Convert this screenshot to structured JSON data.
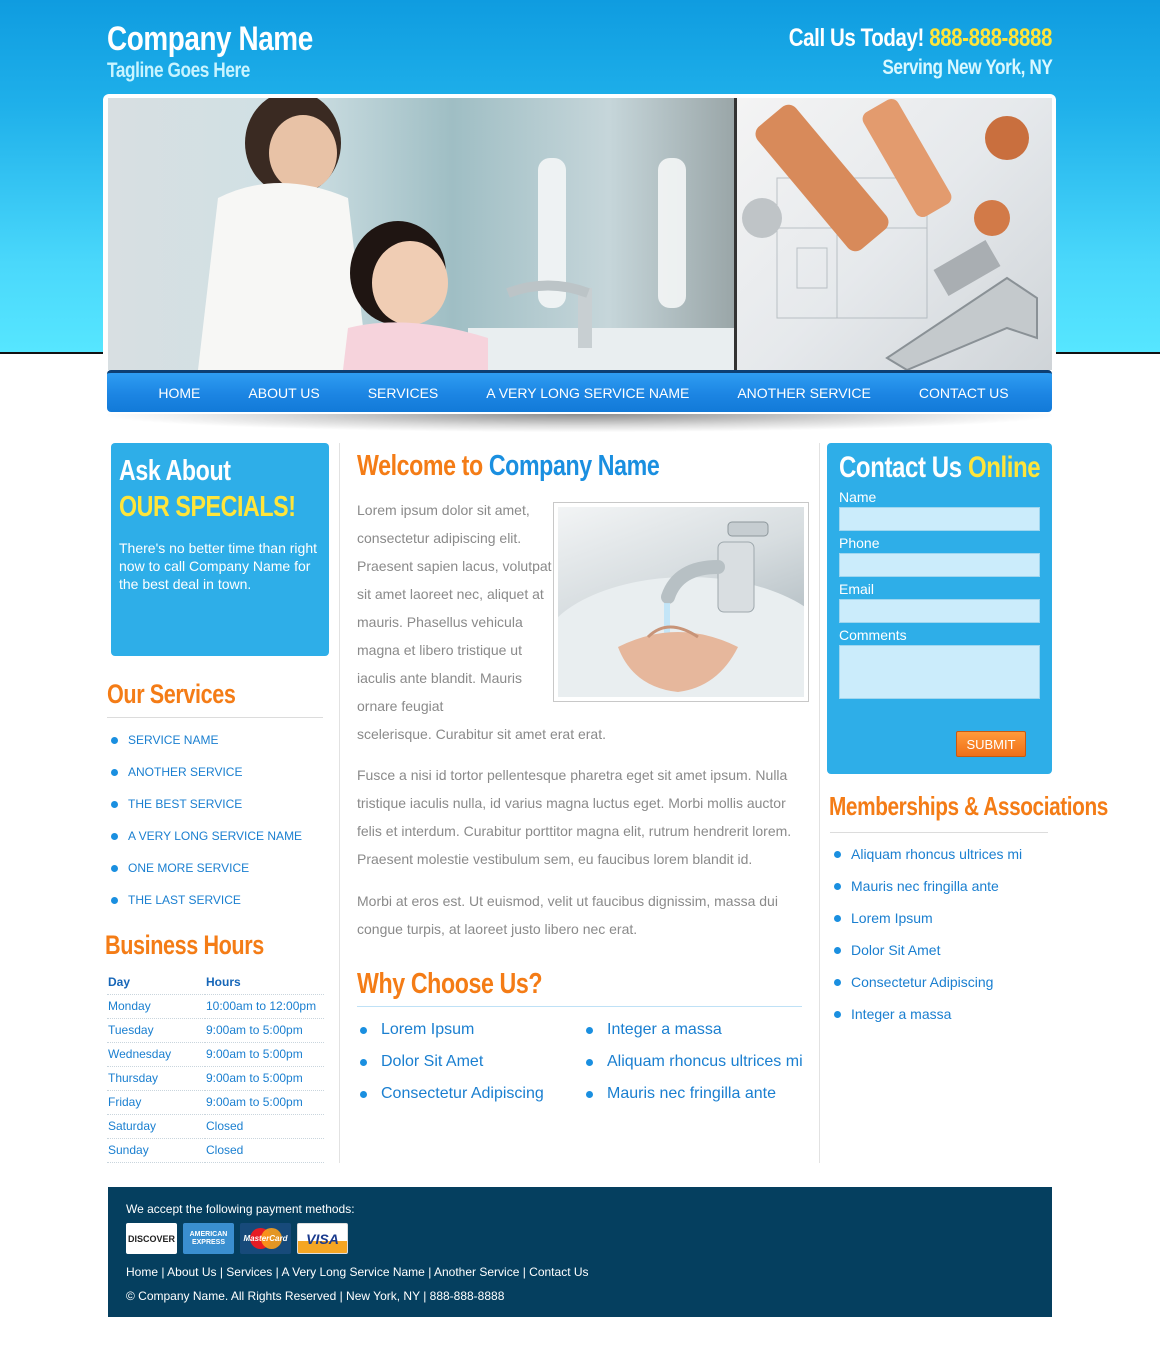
{
  "header": {
    "company_name": "Company Name",
    "tagline": "Tagline Goes Here",
    "call_label": "Call Us Today!",
    "phone": "888-888-8888",
    "serving": "Serving New York, NY"
  },
  "nav": [
    "HOME",
    "ABOUT US",
    "SERVICES",
    "A VERY LONG SERVICE NAME",
    "ANOTHER SERVICE",
    "CONTACT US"
  ],
  "specials": {
    "line1": "Ask About",
    "line2": "OUR SPECIALS!",
    "text": "There's no better time than right now to call Company Name for the best deal in town."
  },
  "services": {
    "title": "Our Services",
    "items": [
      "SERVICE NAME",
      "ANOTHER SERVICE",
      "THE BEST SERVICE",
      "A VERY LONG SERVICE NAME",
      "ONE MORE SERVICE",
      "THE LAST SERVICE"
    ]
  },
  "hours": {
    "title": "Business Hours",
    "col_day": "Day",
    "col_hours": "Hours",
    "rows": [
      {
        "day": "Monday",
        "hours": "10:00am to 12:00pm"
      },
      {
        "day": "Tuesday",
        "hours": "9:00am to 5:00pm"
      },
      {
        "day": "Wednesday",
        "hours": "9:00am to 5:00pm"
      },
      {
        "day": "Thursday",
        "hours": "9:00am to 5:00pm"
      },
      {
        "day": "Friday",
        "hours": "9:00am to 5:00pm"
      },
      {
        "day": "Saturday",
        "hours": "Closed"
      },
      {
        "day": "Sunday",
        "hours": "Closed"
      }
    ]
  },
  "main": {
    "welcome_prefix": "Welcome to",
    "welcome_company": "Company Name",
    "p1": "Lorem ipsum dolor sit amet, consectetur adipiscing elit. Praesent sapien lacus, volutpat sit amet laoreet nec, aliquet at mauris. Phasellus vehicula magna et libero tristique ut iaculis ante blandit. Mauris ornare feugiat",
    "p1_end": "scelerisque. Curabitur sit amet erat erat.",
    "p2": "Fusce a nisi id tortor pellentesque pharetra eget sit amet ipsum. Nulla tristique iaculis nulla, id varius magna luctus eget. Morbi mollis auctor felis et interdum. Curabitur porttitor magna elit, rutrum hendrerit lorem. Praesent molestie vestibulum sem, eu faucibus lorem blandit id.",
    "p3": "Morbi at eros est. Ut euismod, velit ut faucibus dignissim, massa dui congue turpis, at laoreet justo libero nec erat.",
    "why_title": "Why Choose Us?",
    "why_left": [
      "Lorem Ipsum",
      "Dolor Sit Amet",
      "Consectetur Adipiscing"
    ],
    "why_right": [
      "Integer a massa",
      "Aliquam rhoncus ultrices mi",
      "Mauris nec fringilla ante"
    ]
  },
  "contact": {
    "title_a": "Contact Us",
    "title_b": "Online",
    "name_label": "Name",
    "phone_label": "Phone",
    "email_label": "Email",
    "comments_label": "Comments",
    "submit": "SUBMIT"
  },
  "memberships": {
    "title": "Memberships & Associations",
    "items": [
      "Aliquam rhoncus ultrices mi",
      "Mauris nec fringilla ante",
      "Lorem Ipsum",
      "Dolor Sit Amet",
      "Consectetur Adipiscing",
      "Integer a massa"
    ]
  },
  "footer": {
    "payment_text": "We accept the following payment methods:",
    "cards": {
      "discover": "DISCOVER",
      "amex": "AMERICAN EXPRESS",
      "mastercard": "MasterCard",
      "visa": "VISA"
    },
    "links": [
      "Home",
      "About Us",
      "Services",
      "A Very Long Service Name",
      "Another Service",
      "Contact Us"
    ],
    "copyright": "© Company Name. All Rights Reserved | New York, NY | 888-888-8888"
  }
}
